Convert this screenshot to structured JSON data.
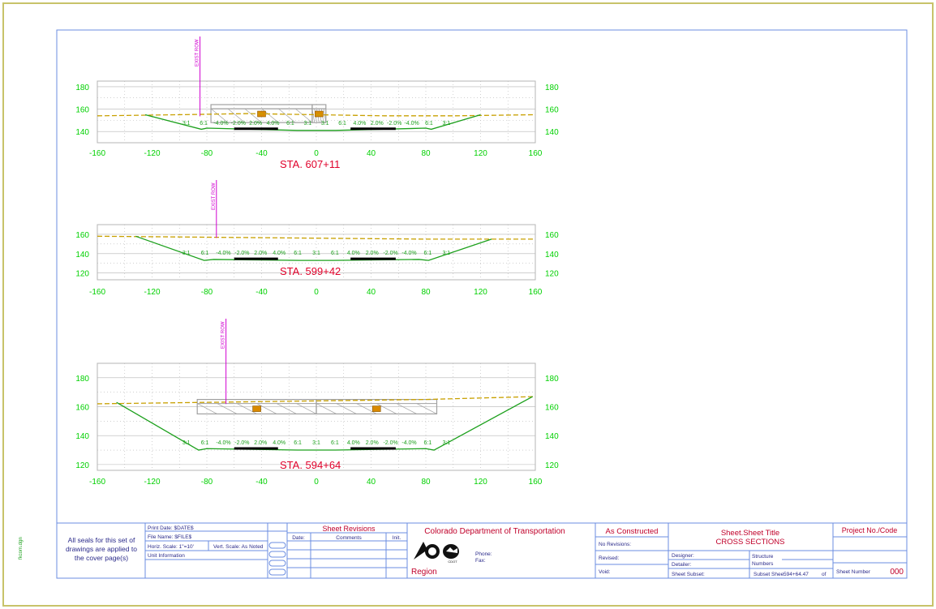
{
  "colors": {
    "sheet_border": "#c8c36a",
    "frame": "#6b8de0",
    "grid": "#b4b4b4",
    "axis_label": "#00d000",
    "ground": "#1ca01c",
    "proposed": "#c8a000",
    "station": "#e0002a",
    "row_marker": "#d000d0",
    "structure": "#a0a0a0",
    "pavement": "#000000",
    "title_block": "#2a2a8a"
  },
  "chart_data": [
    {
      "type": "cross-section",
      "title": "STA. 607+11",
      "xlim": [
        -160,
        160
      ],
      "ylim": [
        130,
        185
      ],
      "x_ticks": [
        -160,
        -120,
        -80,
        -40,
        0,
        40,
        80,
        120,
        160
      ],
      "y_ticks": [
        140,
        160,
        180
      ],
      "row_label": "EXIST ROW",
      "row_x": -85,
      "ground": [
        [
          -125,
          155
        ],
        [
          -84,
          142
        ],
        [
          -80,
          143
        ],
        [
          -14,
          141
        ],
        [
          0,
          141
        ],
        [
          14,
          141
        ],
        [
          80,
          143
        ],
        [
          84,
          142
        ],
        [
          120,
          155
        ]
      ],
      "proposed": [
        [
          -160,
          154
        ],
        [
          -100,
          155
        ],
        [
          -50,
          156
        ],
        [
          0,
          155
        ],
        [
          50,
          154
        ],
        [
          100,
          154
        ],
        [
          160,
          155
        ]
      ],
      "structure": [
        [
          -77,
          148,
          -3,
          164
        ],
        [
          -3,
          148,
          7,
          164
        ]
      ],
      "pavement": [
        [
          -60,
          -28
        ],
        [
          25,
          58
        ]
      ],
      "labels": [
        "3:1",
        "6:1",
        "-4.0%",
        "-2.0%",
        "2.0%",
        "4.0%",
        "6:1",
        "3:1",
        "3:1",
        "6:1",
        "4.0%",
        "2.0%",
        "-2.0%",
        "-4.0%",
        "6:1",
        "3:1"
      ]
    },
    {
      "type": "cross-section",
      "title": "STA. 599+42",
      "xlim": [
        -160,
        160
      ],
      "ylim": [
        113,
        170
      ],
      "x_ticks": [
        -160,
        -120,
        -80,
        -40,
        0,
        40,
        80,
        120,
        160
      ],
      "y_ticks": [
        120,
        140,
        160
      ],
      "row_label": "EXIST ROW",
      "row_x": -73,
      "ground": [
        [
          -132,
          158
        ],
        [
          -82,
          133
        ],
        [
          -75,
          134
        ],
        [
          -12,
          133
        ],
        [
          0,
          133
        ],
        [
          12,
          133
        ],
        [
          75,
          134
        ],
        [
          82,
          133
        ],
        [
          128,
          155
        ]
      ],
      "proposed": [
        [
          -160,
          158
        ],
        [
          -80,
          157
        ],
        [
          0,
          156
        ],
        [
          80,
          155
        ],
        [
          160,
          155
        ]
      ],
      "structure": [],
      "pavement": [
        [
          -60,
          -28
        ],
        [
          25,
          58
        ]
      ],
      "labels": [
        "3:1",
        "6:1",
        "-4.0%",
        "-2.0%",
        "2.0%",
        "4.0%",
        "6:1",
        "3:1",
        "6:1",
        "4.0%",
        "2.0%",
        "-2.0%",
        "-4.0%",
        "6:1",
        "3:1"
      ]
    },
    {
      "type": "cross-section",
      "title": "STA. 594+64",
      "xlim": [
        -160,
        160
      ],
      "ylim": [
        116,
        190
      ],
      "x_ticks": [
        -160,
        -120,
        -80,
        -40,
        0,
        40,
        80,
        120,
        160
      ],
      "y_ticks": [
        120,
        140,
        160,
        180
      ],
      "row_label": "EXIST ROW",
      "row_x": -66,
      "ground": [
        [
          -146,
          163
        ],
        [
          -86,
          130
        ],
        [
          -80,
          131
        ],
        [
          -14,
          130
        ],
        [
          0,
          130
        ],
        [
          14,
          130
        ],
        [
          80,
          131
        ],
        [
          86,
          130
        ],
        [
          158,
          167
        ]
      ],
      "proposed": [
        [
          -160,
          162
        ],
        [
          -80,
          163
        ],
        [
          0,
          164
        ],
        [
          80,
          165
        ],
        [
          160,
          167
        ]
      ],
      "structure": [
        [
          -87,
          155,
          0,
          165
        ],
        [
          0,
          155,
          88,
          165
        ]
      ],
      "pavement": [
        [
          -60,
          -28
        ],
        [
          25,
          58
        ]
      ],
      "labels": [
        "3:1",
        "6:1",
        "-4.0%",
        "-2.0%",
        "2.0%",
        "4.0%",
        "6:1",
        "3:1",
        "6:1",
        "4.0%",
        "2.0%",
        "-2.0%",
        "-4.0%",
        "6:1",
        "3:1"
      ]
    }
  ],
  "side_note": "fkcom.dgn",
  "title_block": {
    "seal_note": "All seals for this set of drawings are applied to the cover page(s)",
    "print_date": "Print Date: $DATE$",
    "file_name": "File Name: $FILE$",
    "horiz_scale": "Horiz. Scale: 1\"=10'",
    "vert_scale": "Vert. Scale: As Noted",
    "unit_info": "Unit Information",
    "sheet_revisions": "Sheet Revisions",
    "col_date": "Date:",
    "col_comments": "Comments",
    "col_init": "Init.",
    "agency": "Colorado Department of Transportation",
    "phone": "Phone:",
    "fax": "Fax:",
    "region": "Region",
    "as_constructed": "As Constructed",
    "no_revisions": "No Revisions:",
    "revised": "Revised:",
    "void": "Void:",
    "sheet_title_line1": "Sheet.Sheet Title",
    "sheet_title_line2": "CROSS SECTIONS",
    "designer": "Designer:",
    "detailer": "Detailer:",
    "structure_numbers": "Structure Numbers",
    "sheet_subset": "Sheet Subset:",
    "subset_sheets": "Subset Sheets:",
    "subset_value": "594+64.47",
    "of": "of",
    "project_no": "Project No./Code",
    "sheet_number": "Sheet Number",
    "sheet_number_value": "000"
  }
}
